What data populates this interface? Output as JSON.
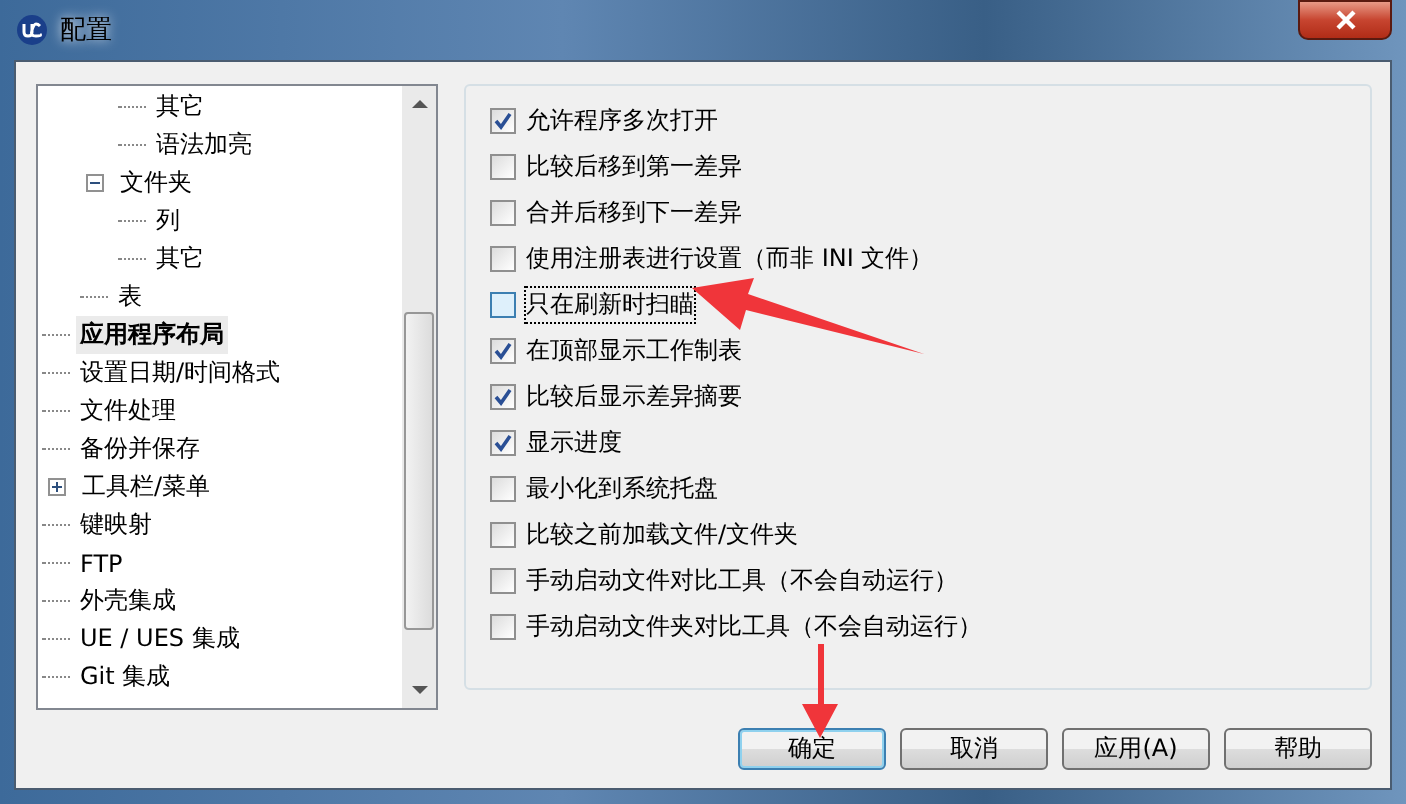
{
  "window": {
    "title": "配置"
  },
  "tree": [
    {
      "children": [
        {
          "children": [
            {
              "label": "其它",
              "selected": false
            },
            {
              "label": "语法加亮",
              "selected": false
            }
          ]
        },
        {
          "label": "文件夹",
          "expanded": true,
          "selected": false,
          "children": [
            {
              "label": "列",
              "selected": false
            },
            {
              "label": "其它",
              "selected": false
            }
          ]
        },
        {
          "label": "表",
          "selected": false
        }
      ]
    },
    {
      "label": "应用程序布局",
      "selected": true
    },
    {
      "label": "设置日期/时间格式",
      "selected": false
    },
    {
      "label": "文件处理",
      "selected": false
    },
    {
      "label": "备份并保存",
      "selected": false
    },
    {
      "label": "工具栏/菜单",
      "expanded": false,
      "selected": false
    },
    {
      "label": "键映射",
      "selected": false
    },
    {
      "label": "FTP",
      "selected": false
    },
    {
      "label": "外壳集成",
      "selected": false
    },
    {
      "label": "UE / UES 集成",
      "selected": false
    },
    {
      "label": "Git 集成",
      "selected": false
    }
  ],
  "options": [
    {
      "label": "允许程序多次打开",
      "checked": true
    },
    {
      "label": "比较后移到第一差异",
      "checked": false
    },
    {
      "label": "合并后移到下一差异",
      "checked": false
    },
    {
      "label": "使用注册表进行设置（而非 INI 文件）",
      "checked": false
    },
    {
      "label": "只在刷新时扫瞄",
      "checked": false
    },
    {
      "label": "在顶部显示工作制表",
      "checked": true
    },
    {
      "label": "比较后显示差异摘要",
      "checked": true
    },
    {
      "label": "显示进度",
      "checked": true
    },
    {
      "label": "最小化到系统托盘",
      "checked": false
    },
    {
      "label": "比较之前加载文件/文件夹",
      "checked": false
    },
    {
      "label": "手动启动文件对比工具（不会自动运行）",
      "checked": false
    },
    {
      "label": "手动启动文件夹对比工具（不会自动运行）",
      "checked": false
    }
  ],
  "buttons": [
    {
      "label": "确定",
      "default": true
    },
    {
      "label": "取消",
      "default": false
    },
    {
      "label": "应用(A)",
      "default": false
    },
    {
      "label": "帮助",
      "default": false
    }
  ]
}
